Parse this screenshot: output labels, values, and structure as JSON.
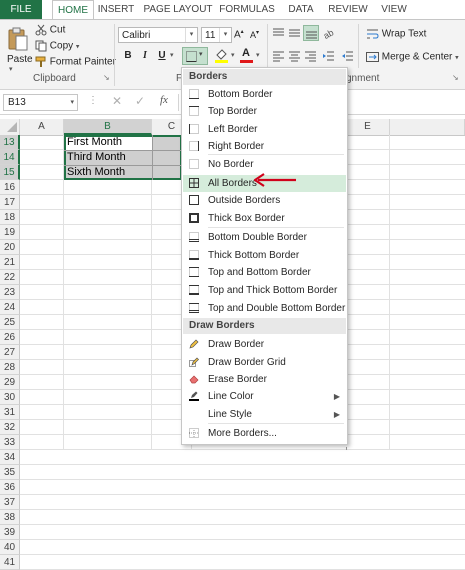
{
  "ribbon": {
    "tabs": [
      "FILE",
      "HOME",
      "INSERT",
      "PAGE LAYOUT",
      "FORMULAS",
      "DATA",
      "REVIEW",
      "VIEW"
    ],
    "clipboard": {
      "paste": "Paste",
      "cut": "Cut",
      "copy": "Copy",
      "format_painter": "Format Painter",
      "group": "Clipboard"
    },
    "font": {
      "name": "Calibri",
      "size": "11",
      "bold": "B",
      "italic": "I",
      "underline": "U",
      "font_color_letter": "A",
      "group_partial": "F"
    },
    "alignment": {
      "wrap_text": "Wrap Text",
      "merge_center": "Merge & Center",
      "group_partial": "gnment"
    }
  },
  "formula_bar": {
    "name_box": "B13",
    "fx": "fx"
  },
  "grid": {
    "columns": [
      "A",
      "B",
      "C",
      "D",
      "E"
    ],
    "rows": [
      "13",
      "14",
      "15",
      "16",
      "17",
      "18",
      "19",
      "20",
      "21",
      "22",
      "23",
      "24",
      "25",
      "26",
      "27",
      "28",
      "29",
      "30",
      "31",
      "32",
      "33",
      "34",
      "35",
      "36",
      "37",
      "38",
      "39",
      "40",
      "41"
    ],
    "cells": {
      "b13": "First Month",
      "b14": "Third Month",
      "b15": "Sixth Month"
    }
  },
  "menu": {
    "header_borders": "Borders",
    "items": [
      "Bottom Border",
      "Top Border",
      "Left Border",
      "Right Border",
      "No Border",
      "All Borders",
      "Outside Borders",
      "Thick Box Border",
      "Bottom Double Border",
      "Thick Bottom Border",
      "Top and Bottom Border",
      "Top and Thick Bottom Border",
      "Top and Double Bottom Border"
    ],
    "header_draw": "Draw Borders",
    "draw_items": [
      "Draw Border",
      "Draw Border Grid",
      "Erase Border",
      "Line Color",
      "Line Style",
      "More Borders..."
    ]
  },
  "colors": {
    "excel_green": "#217346",
    "menu_highlight": "#d5ecdb",
    "arrow": "#d0021b"
  }
}
